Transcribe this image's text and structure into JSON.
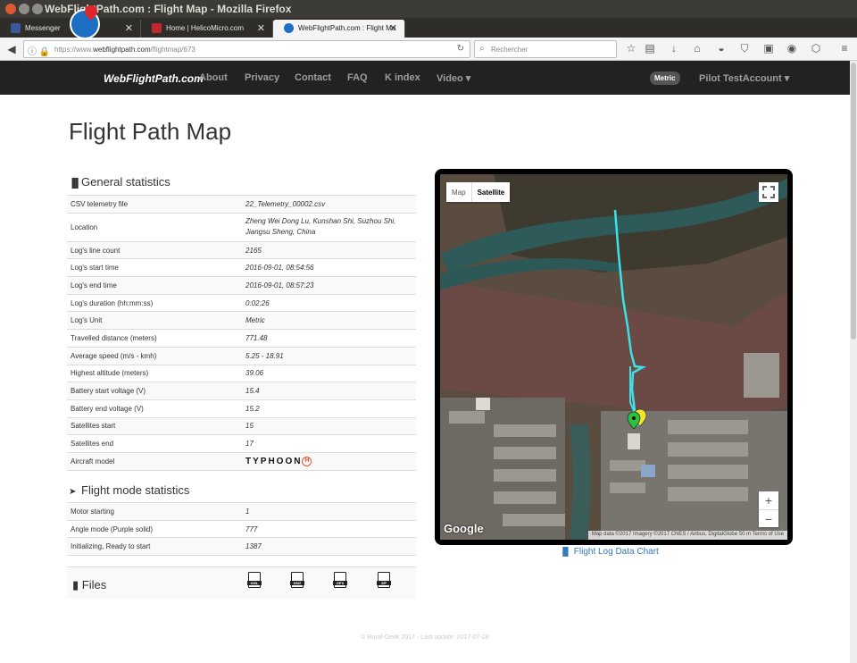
{
  "window": {
    "title": "WebFlightPath.com : Flight Map - Mozilla Firefox"
  },
  "tabs": [
    {
      "label": "Messenger",
      "favicon_color": "#3b5998"
    },
    {
      "label": "Home | HelicoMicro.com",
      "favicon_color": "#c0282e"
    },
    {
      "label": "WebFlightPath.com : Flight Ma",
      "favicon_color": "#1c6fc2"
    }
  ],
  "browser": {
    "url_prefix": "https://www.",
    "url_domain": "webflightpath.com",
    "url_path": "/flightmap/673",
    "search_placeholder": "Rechercher"
  },
  "site": {
    "logo_text": "WebFlightPath.com",
    "menu": [
      "About",
      "Privacy",
      "Contact",
      "FAQ",
      "K index",
      "Video ▾"
    ],
    "metric_badge": "Metric",
    "pilot_menu": "Pilot TestAccount ▾"
  },
  "page": {
    "title": "Flight Path Map"
  },
  "general_stats": {
    "title": "General statistics",
    "rows": [
      {
        "label": "CSV telemetry file",
        "value": "22_Telemetry_00002.csv"
      },
      {
        "label": "Location",
        "value": "Zheng Wei Dong Lu, Kunshan Shi, Suzhou Shi, Jiangsu Sheng, China"
      },
      {
        "label": "Log's line count",
        "value": "2165"
      },
      {
        "label": "Log's start time",
        "value": "2016-09-01, 08:54:56"
      },
      {
        "label": "Log's end time",
        "value": "2016-09-01, 08:57:23"
      },
      {
        "label": "Log's duration (hh:mm:ss)",
        "value": "0:02:26"
      },
      {
        "label": "Log's Unit",
        "value": "Metric"
      },
      {
        "label": "Travelled distance (meters)",
        "value": "771.48"
      },
      {
        "label": "Average speed (m/s - kmh)",
        "value": "5.25 - 18.91"
      },
      {
        "label": "Highest altitude (meters)",
        "value": "39.06"
      },
      {
        "label": "Battery start voltage (V)",
        "value": "15.4"
      },
      {
        "label": "Battery end voltage (V)",
        "value": "15.2"
      },
      {
        "label": "Satellites start",
        "value": "15"
      },
      {
        "label": "Satellites end",
        "value": "17"
      },
      {
        "label": "Aircraft model",
        "value": "TYPHOON"
      }
    ]
  },
  "flight_mode_stats": {
    "title": "Flight mode statistics",
    "rows": [
      {
        "label": "Motor starting",
        "value": "1"
      },
      {
        "label": "Angle mode (Purple solid)",
        "value": "777"
      },
      {
        "label": "Initializing, Ready to start",
        "value": "1387"
      }
    ]
  },
  "files": {
    "label": "Files",
    "items": [
      "KML",
      "KMZ",
      "GPX",
      "ZIP"
    ]
  },
  "map": {
    "toggle_map": "Map",
    "toggle_satellite": "Satellite",
    "zoom_in": "+",
    "zoom_out": "−",
    "google": "Google",
    "attribution": "Map data ©2017 Imagery ©2017 CNES / Airbus, DigitalGlobe   50 m   Terms of Use",
    "path_color": "#3fe0e8"
  },
  "chart_link": "Flight Log Data Chart",
  "footer": "© Rural-Geek 2017 - Last update: 2017-07-28"
}
